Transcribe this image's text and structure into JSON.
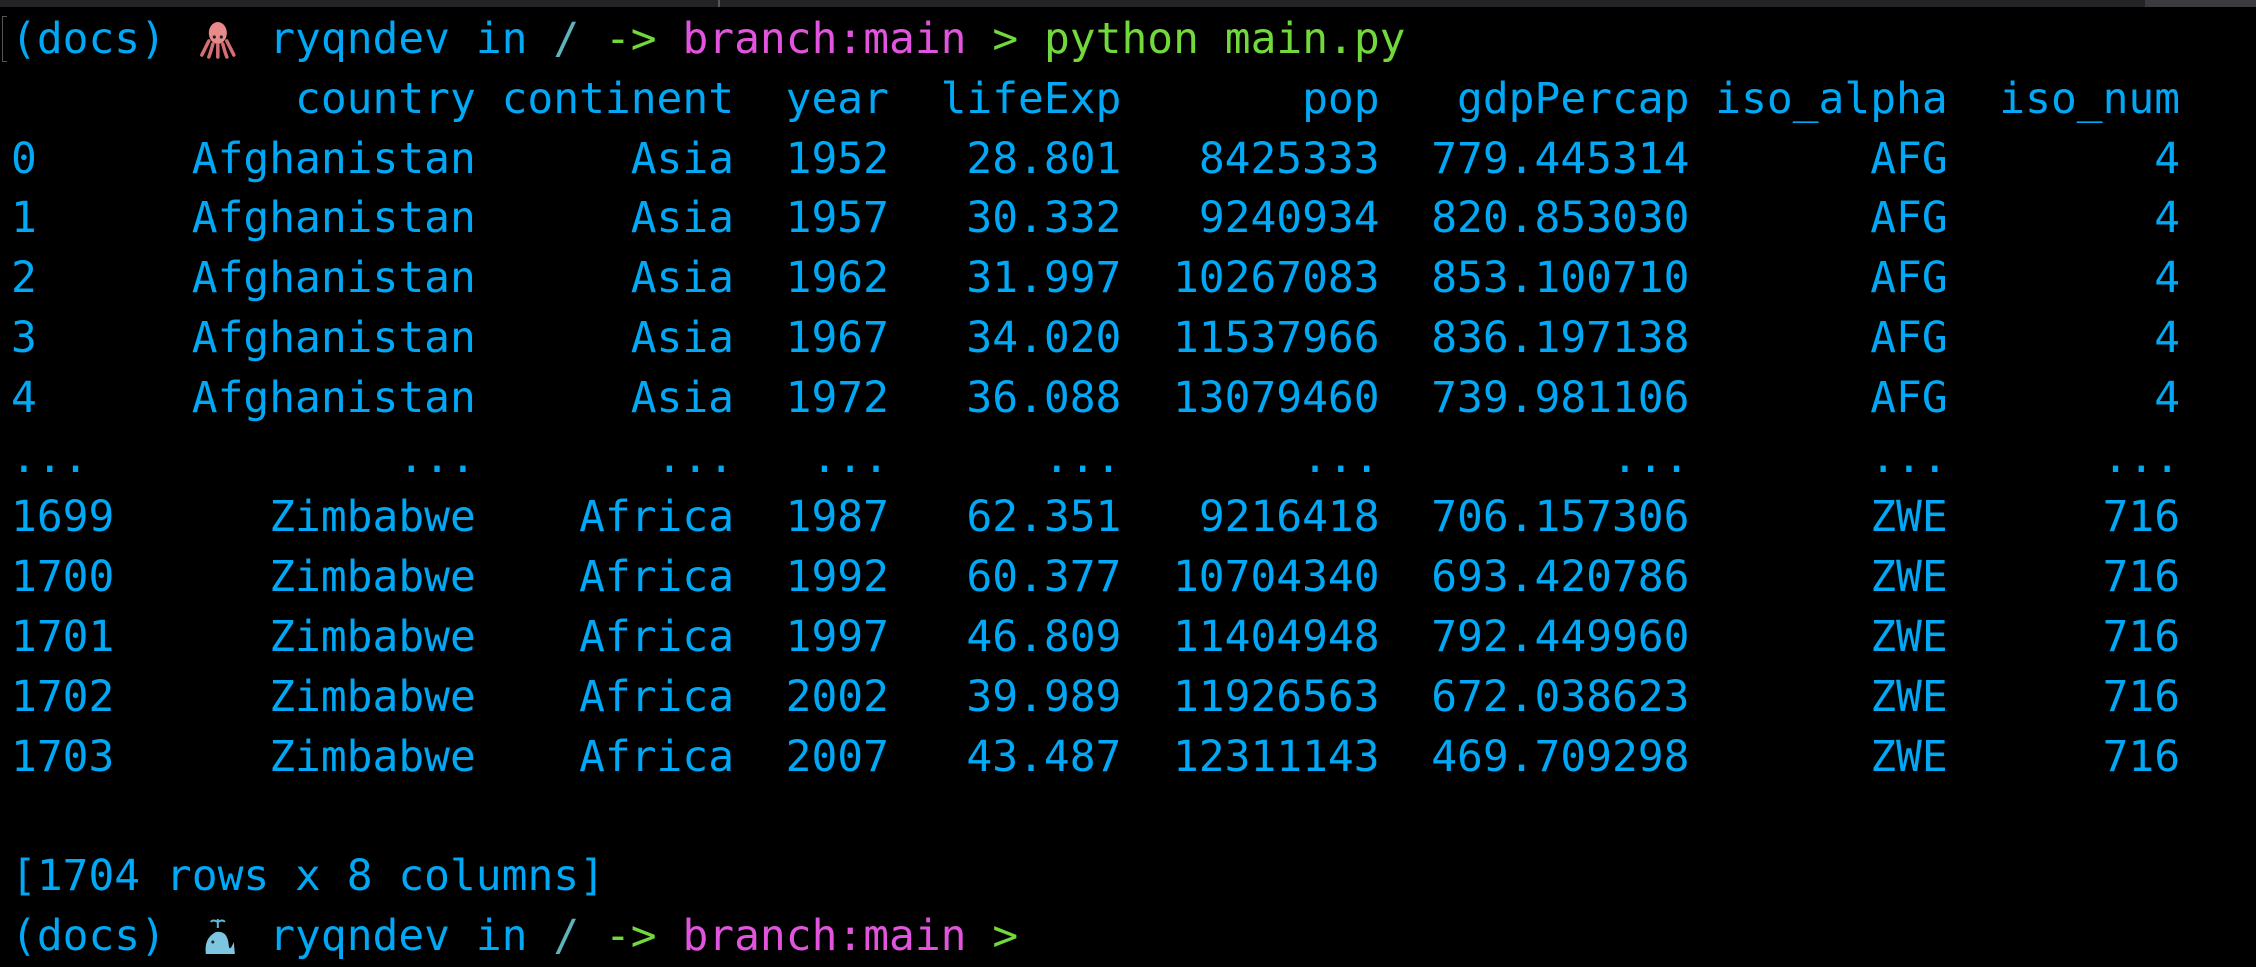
{
  "prompt": {
    "env": "(docs)",
    "emoji_icon": "octopus-icon",
    "user": "ryqndev",
    "in": "in",
    "path": "/",
    "arrow": "->",
    "branch": "branch:main",
    "caret": ">",
    "command": "python main.py"
  },
  "table": {
    "columns": [
      "country",
      "continent",
      "year",
      "lifeExp",
      "pop",
      "gdpPercap",
      "iso_alpha",
      "iso_num"
    ],
    "rows": [
      [
        "0",
        "Afghanistan",
        "Asia",
        "1952",
        "28.801",
        "8425333",
        "779.445314",
        "AFG",
        "4"
      ],
      [
        "1",
        "Afghanistan",
        "Asia",
        "1957",
        "30.332",
        "9240934",
        "820.853030",
        "AFG",
        "4"
      ],
      [
        "2",
        "Afghanistan",
        "Asia",
        "1962",
        "31.997",
        "10267083",
        "853.100710",
        "AFG",
        "4"
      ],
      [
        "3",
        "Afghanistan",
        "Asia",
        "1967",
        "34.020",
        "11537966",
        "836.197138",
        "AFG",
        "4"
      ],
      [
        "4",
        "Afghanistan",
        "Asia",
        "1972",
        "36.088",
        "13079460",
        "739.981106",
        "AFG",
        "4"
      ],
      [
        "...",
        "...",
        "...",
        "...",
        "...",
        "...",
        "...",
        "...",
        "..."
      ],
      [
        "1699",
        "Zimbabwe",
        "Africa",
        "1987",
        "62.351",
        "9216418",
        "706.157306",
        "ZWE",
        "716"
      ],
      [
        "1700",
        "Zimbabwe",
        "Africa",
        "1992",
        "60.377",
        "10704340",
        "693.420786",
        "ZWE",
        "716"
      ],
      [
        "1701",
        "Zimbabwe",
        "Africa",
        "1997",
        "46.809",
        "11404948",
        "792.449960",
        "ZWE",
        "716"
      ],
      [
        "1702",
        "Zimbabwe",
        "Africa",
        "2002",
        "39.989",
        "11926563",
        "672.038623",
        "ZWE",
        "716"
      ],
      [
        "1703",
        "Zimbabwe",
        "Africa",
        "2007",
        "43.487",
        "12311143",
        "469.709298",
        "ZWE",
        "716"
      ]
    ],
    "summary": "[1704 rows x 8 columns]"
  },
  "prompt2": {
    "env": "(docs)",
    "emoji_icon": "whale-icon",
    "user": "ryqndev",
    "in": "in",
    "path": "/",
    "arrow": "->",
    "branch": "branch:main",
    "caret": ">"
  },
  "colors": {
    "text": "#00a8f5",
    "path": "#5fb3bd",
    "green": "#72d93c",
    "branch": "#e254dd",
    "background": "#000000"
  }
}
